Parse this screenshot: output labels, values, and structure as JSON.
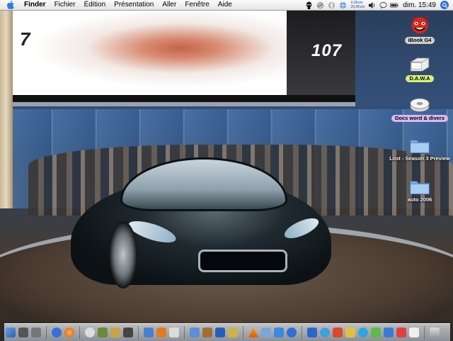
{
  "menubar": {
    "app_name": "Finder",
    "items": [
      "Fichier",
      "Édition",
      "Présentation",
      "Aller",
      "Fenêtre",
      "Aide"
    ],
    "net_up": "0,0Ko/s",
    "net_down": "25,0Ko/s",
    "clock": "dim. 15:49"
  },
  "wallpaper": {
    "banner_left": "7",
    "banner_right": "107"
  },
  "desktop_icons": [
    {
      "label": "iBook G4",
      "icon": "demon-icon"
    },
    {
      "label": "D.A.W.A",
      "icon": "drive-icon"
    },
    {
      "label": "Docs word & divers",
      "icon": "disk-icon"
    },
    {
      "label": "Lost - Season 3 Preview",
      "icon": "folder-icon"
    },
    {
      "label": "auto 2006",
      "icon": "folder-icon"
    }
  ],
  "colors": {
    "label_green": "#d6f07a",
    "label_purple": "#d9b8f0",
    "label_gray": "#cfcfcf",
    "spotlight": "#2f6fd6"
  },
  "dock": {
    "icons": [
      "finder",
      "monitor",
      "dashboard",
      "itunes",
      "safari",
      "cd",
      "chess",
      "ical",
      "address",
      "photo",
      "mail",
      "word",
      "powerpoint",
      "excel",
      "folder",
      "quicktime",
      "itunes2",
      "sherlock",
      "vlc",
      "preview",
      "imovie",
      "idvd",
      "iphoto",
      "garageband",
      "ichat",
      "skype",
      "system-prefs",
      "calculator",
      "trash"
    ]
  }
}
